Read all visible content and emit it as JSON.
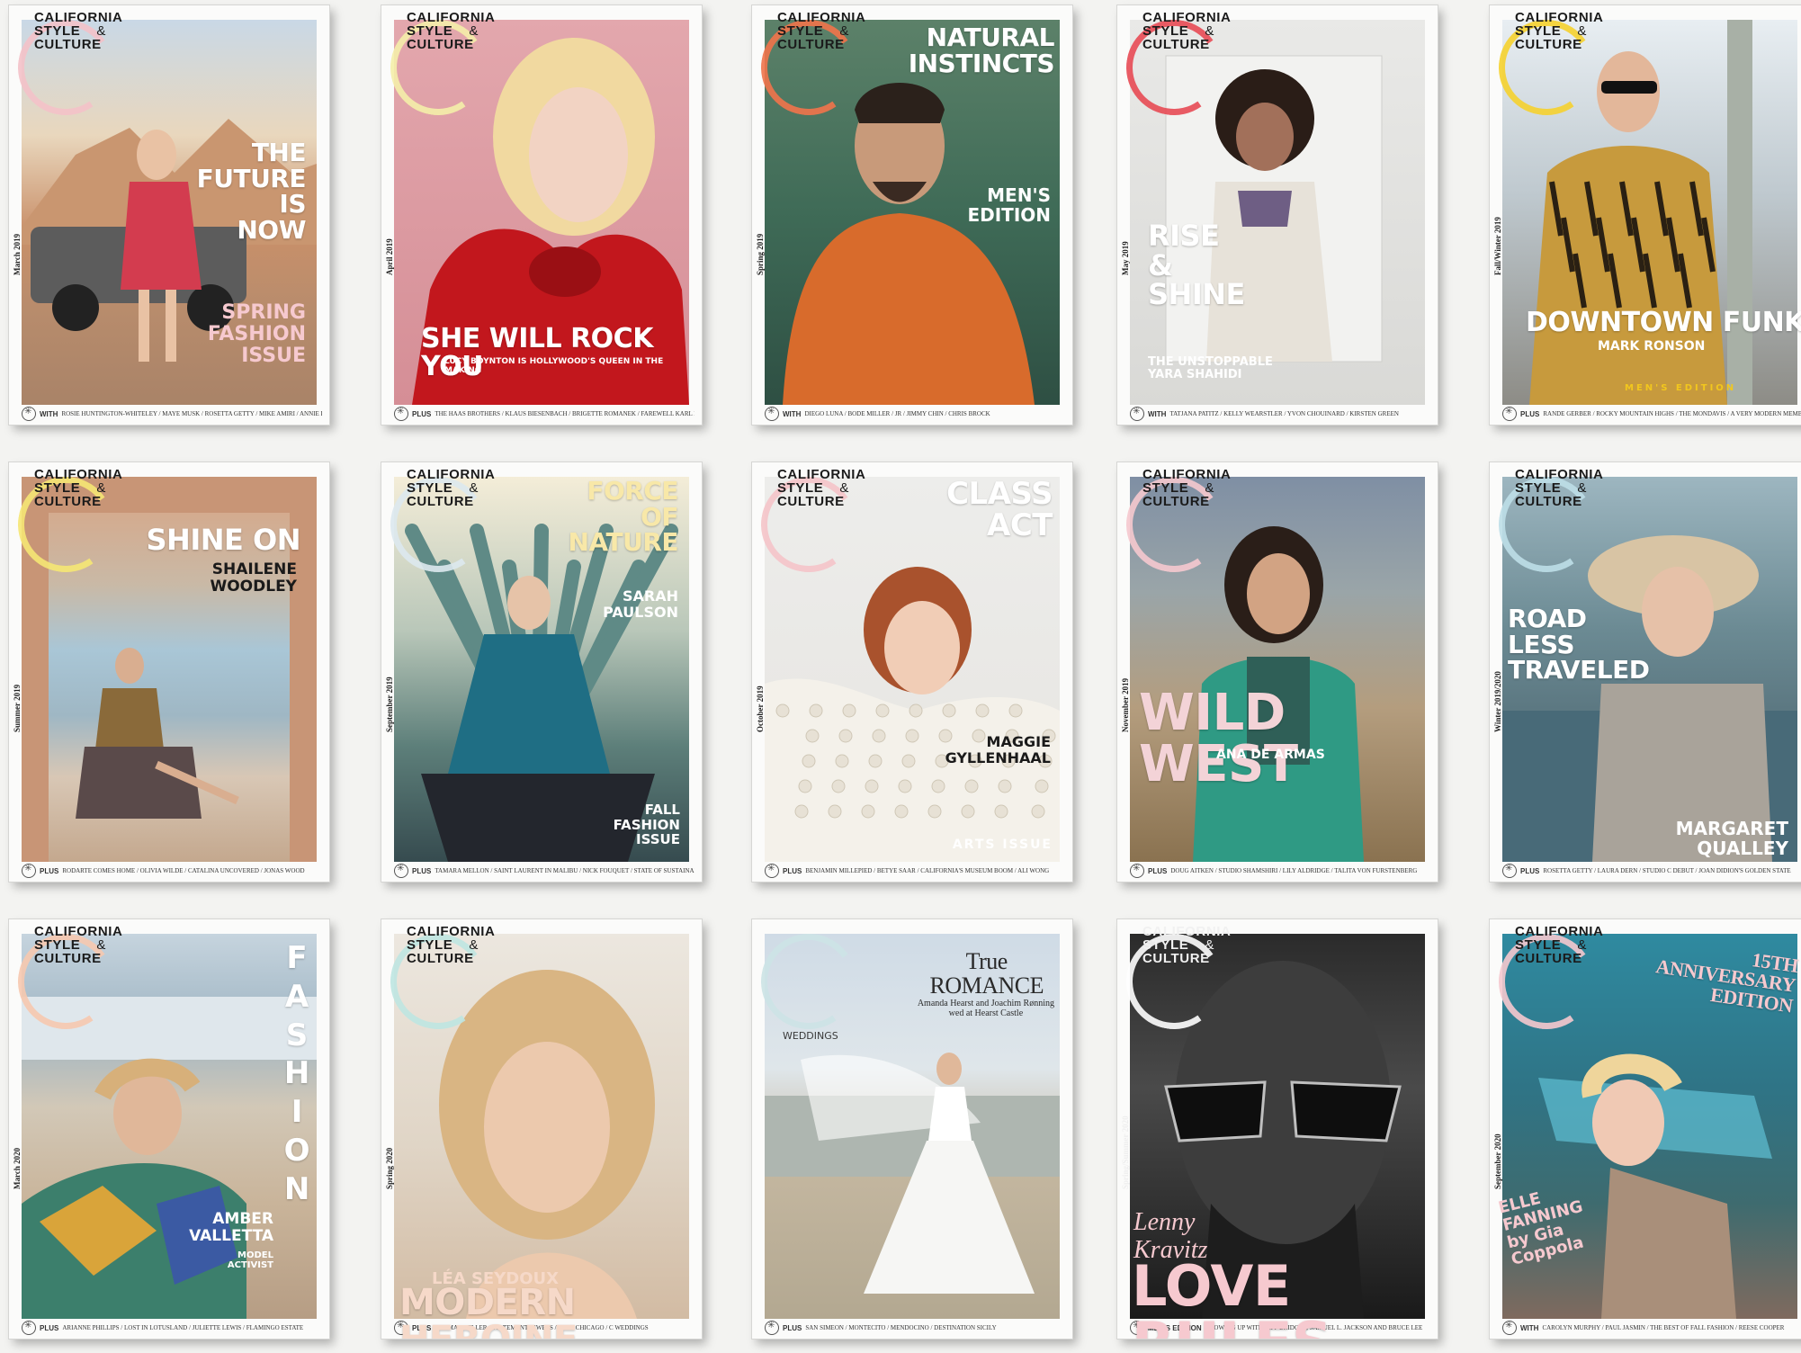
{
  "logo": {
    "line1": "CALIFORNIA",
    "line2": "STYLE",
    "amp": "&",
    "line3": "CULTURE"
  },
  "covers": [
    {
      "issue": "March 2019",
      "ring": "#f4c2c9",
      "bg": "linear-gradient(180deg,#c9d8e6 0%,#e9d7bd 30%,#c9906a 55%,#b88c6c 75%,#a98368 100%)",
      "lines": [
        "THE",
        "FUTURE",
        "IS",
        "NOW"
      ],
      "head_color": "#ffffff",
      "sub": [
        "SPRING",
        "FASHION",
        "ISSUE"
      ],
      "sub_color": "#f6c9cf",
      "foot_lead": "WITH",
      "foot": "ROSIE HUNTINGTON-WHITELEY / MAYE MUSK / ROSETTA GETTY / MIKE AMIRI / ANNIE LEIBOVITZ",
      "subject": "car"
    },
    {
      "issue": "April 2019",
      "ring": "#f5efaa",
      "bg": "linear-gradient(180deg,#e3a7ad 0%,#d58e96 100%)",
      "lines": [
        "SHE WILL ROCK YOU"
      ],
      "head_color": "#ffffff",
      "sub": [
        "LUCY BOYNTON IS HOLLYWOOD'S QUEEN IN THE MAKING"
      ],
      "sub_color": "#ffffff",
      "foot_lead": "PLUS",
      "foot": "THE HAAS BROTHERS / KLAUS BIESENBACH / BRIGETTE ROMANEK / FAREWELL KARL LAGERFELD",
      "subject": "bow"
    },
    {
      "issue": "Spring 2019",
      "ring": "#f1744b",
      "bg": "linear-gradient(180deg,#5c8169 0%,#3f6b57 50%,#2e4f43 100%)",
      "lines": [
        "NATURAL",
        "INSTINCTS"
      ],
      "head_color": "#ffffff",
      "sub": [
        "MEN'S",
        "EDITION"
      ],
      "sub_color": "#ffffff",
      "foot_lead": "WITH",
      "foot": "DIEGO LUNA / BODE MILLER / JR / JIMMY CHIN / CHRIS BROCK",
      "subject": "sweater"
    },
    {
      "issue": "May 2019",
      "ring": "#e84b55",
      "bg": "linear-gradient(180deg,#e9e9e7 0%,#d9d9d6 100%)",
      "lines": [
        "RISE",
        "&",
        "SHINE"
      ],
      "head_color": "#ffffff",
      "sub": [
        "THE UNSTOPPABLE",
        "YARA SHAHIDI"
      ],
      "sub_color": "#ffffff",
      "foot_lead": "WITH",
      "foot": "TATJANA PATITZ / KELLY WEARSTLER / YVON CHOUINARD / KIRSTEN GREEN",
      "subject": "collage"
    },
    {
      "issue": "Fall/Winter 2019",
      "ring": "#f6d22f",
      "bg": "linear-gradient(180deg,#e8eef2 0%,#bfc9cf 45%,#8d8c86 100%)",
      "lines": [
        "DOWNTOWN FUNK"
      ],
      "head_color": "#ffffff",
      "sub": [
        "MARK RONSON"
      ],
      "sub_color": "#ffffff",
      "extra": "MEN'S EDITION",
      "extra_color": "#f2c71d",
      "foot_lead": "PLUS",
      "foot": "RANDE GERBER / ROCKY MOUNTAIN HIGHS / THE MONDAVIS / A VERY MODERN MEMBERS CLUB",
      "subject": "tiger"
    },
    {
      "issue": "Summer 2019",
      "ring": "#f6e774",
      "bg": "linear-gradient(180deg,#d9a483 0%,#c9b9a6 28%,#a9c6d6 45%,#9fb7c4 62%,#d8c7b5 78%,#c4a88e 100%)",
      "lines": [
        "SHINE ON"
      ],
      "head_color": "#ffffff",
      "sub": [
        "SHAILENE",
        "WOODLEY"
      ],
      "sub_color": "#1a1a1a",
      "foot_lead": "PLUS",
      "foot": "RODARTE COMES HOME / OLIVIA WILDE / CATALINA UNCOVERED / JONAS WOOD",
      "subject": "chair"
    },
    {
      "issue": "September 2019",
      "ring": "#dde9ef",
      "bg": "linear-gradient(180deg,#f4edd8 0%,#b9c7b9 40%,#5d7f7a 70%,#364b4f 100%)",
      "lines": [
        "FORCE",
        "OF",
        "NATURE"
      ],
      "head_color": "#f8e8a8",
      "sub": [
        "SARAH",
        "PAULSON"
      ],
      "sub_color": "#ffffff",
      "sub2": [
        "FALL",
        "FASHION",
        "ISSUE"
      ],
      "sub2_color": "#ffffff",
      "foot_lead": "PLUS",
      "foot": "TAMARA MELLON / SAINT LAURENT IN MALIBU / NICK FOUQUET / STATE OF SUSTAINABILITY",
      "subject": "agave"
    },
    {
      "issue": "October 2019",
      "ring": "#f5c5c9",
      "bg": "linear-gradient(180deg,#ededeb 0%,#e6e4e0 100%)",
      "lines": [
        "CLASS",
        "ACT"
      ],
      "head_color": "#ffffff",
      "sub": [
        "MAGGIE",
        "GYLLENHAAL"
      ],
      "sub_color": "#1a1a1a",
      "extra": "ARTS ISSUE",
      "extra_color": "#ffffff",
      "foot_lead": "PLUS",
      "foot": "BENJAMIN MILLEPIED / BETYE SAAR / CALIFORNIA'S MUSEUM BOOM / ALI WONG",
      "subject": "pearls"
    },
    {
      "issue": "November 2019",
      "ring": "#f6c9cf",
      "bg": "linear-gradient(180deg,#7f8fa4 0%,#9aa5a8 30%,#b49d7e 60%,#8a7250 100%)",
      "lines": [
        "WILD WEST"
      ],
      "head_color": "#f3d3d7",
      "sub": [
        "ANA DE ARMAS"
      ],
      "sub_color": "#ffffff",
      "foot_lead": "PLUS",
      "foot": "DOUG AITKEN / STUDIO SHAMSHIRI / LILY ALDRIDGE / TALITA VON FURSTENBERG",
      "subject": "green-dress"
    },
    {
      "issue": "Winter 2019/2020",
      "ring": "#bedfe8",
      "bg": "linear-gradient(180deg,#9db6c0 0%,#6b8a93 40%,#3f5560 100%)",
      "lines": [
        "ROAD",
        "LESS",
        "TRAVELED"
      ],
      "head_color": "#ffffff",
      "sub": [
        "MARGARET",
        "QUALLEY"
      ],
      "sub_color": "#ffffff",
      "foot_lead": "PLUS",
      "foot": "ROSETTA GETTY / LAURA DERN / STUDIO C DEBUT / JOAN DIDION'S GOLDEN STATE",
      "subject": "hat"
    },
    {
      "issue": "March 2020",
      "ring": "#f7c9b0",
      "bg": "linear-gradient(180deg,#c6d4de 0%,#9fb5c3 25%,#d2c8b7 45%,#c9b49a 70%,#b69d84 100%)",
      "lines": [
        "F",
        "A",
        "S",
        "H",
        "I",
        "O",
        "N"
      ],
      "head_color": "#ffffff",
      "sub": [
        "AMBER",
        "VALLETTA"
      ],
      "sub_color": "#ffffff",
      "sub2": [
        "MODEL",
        "ACTIVIST"
      ],
      "sub2_color": "#ffffff",
      "foot_lead": "PLUS",
      "foot": "ARIANNE PHILLIPS / LOST IN LOTUSLAND / JULIETTE LEWIS / FLAMINGO ESTATE",
      "subject": "silk"
    },
    {
      "issue": "Spring 2020",
      "ring": "#bfe6e2",
      "bg": "linear-gradient(180deg,#ece7df 0%,#e0d5c6 55%,#d2bba3 100%)",
      "lines": [
        "MODERN HEROINE"
      ],
      "head_color": "#f6d9c9",
      "sub": [
        "LÉA SEYDOUX"
      ],
      "sub_color": "#f6d9c9",
      "foot_lead": "PLUS",
      "foot": "THOMAS KELLER / STATEMENT JEWELS / JUDY CHICAGO / C WEDDINGS",
      "subject": "blonde"
    },
    {
      "issue": "",
      "ring": "#cde4e6",
      "bg": "linear-gradient(180deg,#cfdbe6 0%,#dfe6ea 35%,#c4b7a0 60%,#b3a891 100%)",
      "lines": [
        "True",
        "ROMANCE"
      ],
      "head_color": "#2a2a2a",
      "sub": [
        "Amanda Hearst and Joachim Rønning",
        "wed at Hearst Castle"
      ],
      "sub_color": "#2a2a2a",
      "extra": "WEDDINGS",
      "extra_color": "#3a3a3a",
      "foot_lead": "PLUS",
      "foot": "SAN SIMEON / MONTECITO / MENDOCINO / DESTINATION SICILY",
      "subject": "bride"
    },
    {
      "issue": "Spring/Summer 2020",
      "ring": "#ffffff",
      "bg": "linear-gradient(180deg,#2b2b2b 0%,#4a4a4a 40%,#1a1a1a 100%)",
      "lines": [
        "LOVE RULES"
      ],
      "head_color": "#f6c9cf",
      "sub": [
        "Lenny",
        "Kravitz"
      ],
      "sub_color": "#f6c9cf",
      "foot_lead": "MEN'S EDITION",
      "foot": "GROWING UP WITH JEFF BRIDGES, SAMUEL L. JACKSON AND BRUCE LEE",
      "subject": "sunglasses"
    },
    {
      "issue": "September 2020",
      "ring": "#f6c9cf",
      "bg": "linear-gradient(180deg,#2f8aa0 0%,#2f7486 40%,#3e6b6f 70%,#7f6a5e 100%)",
      "lines": [
        "15th",
        "ANNIVERSARY",
        "EDITION"
      ],
      "head_color": "#f6c9cf",
      "sub": [
        "ELLE",
        "FANNING",
        "by Gia",
        "Coppola"
      ],
      "sub_color": "#f6c9cf",
      "foot_lead": "WITH",
      "foot": "CAROLYN MURPHY / PAUL JASMIN / THE BEST OF FALL FASHION / REESE COOPER",
      "subject": "pool"
    }
  ]
}
